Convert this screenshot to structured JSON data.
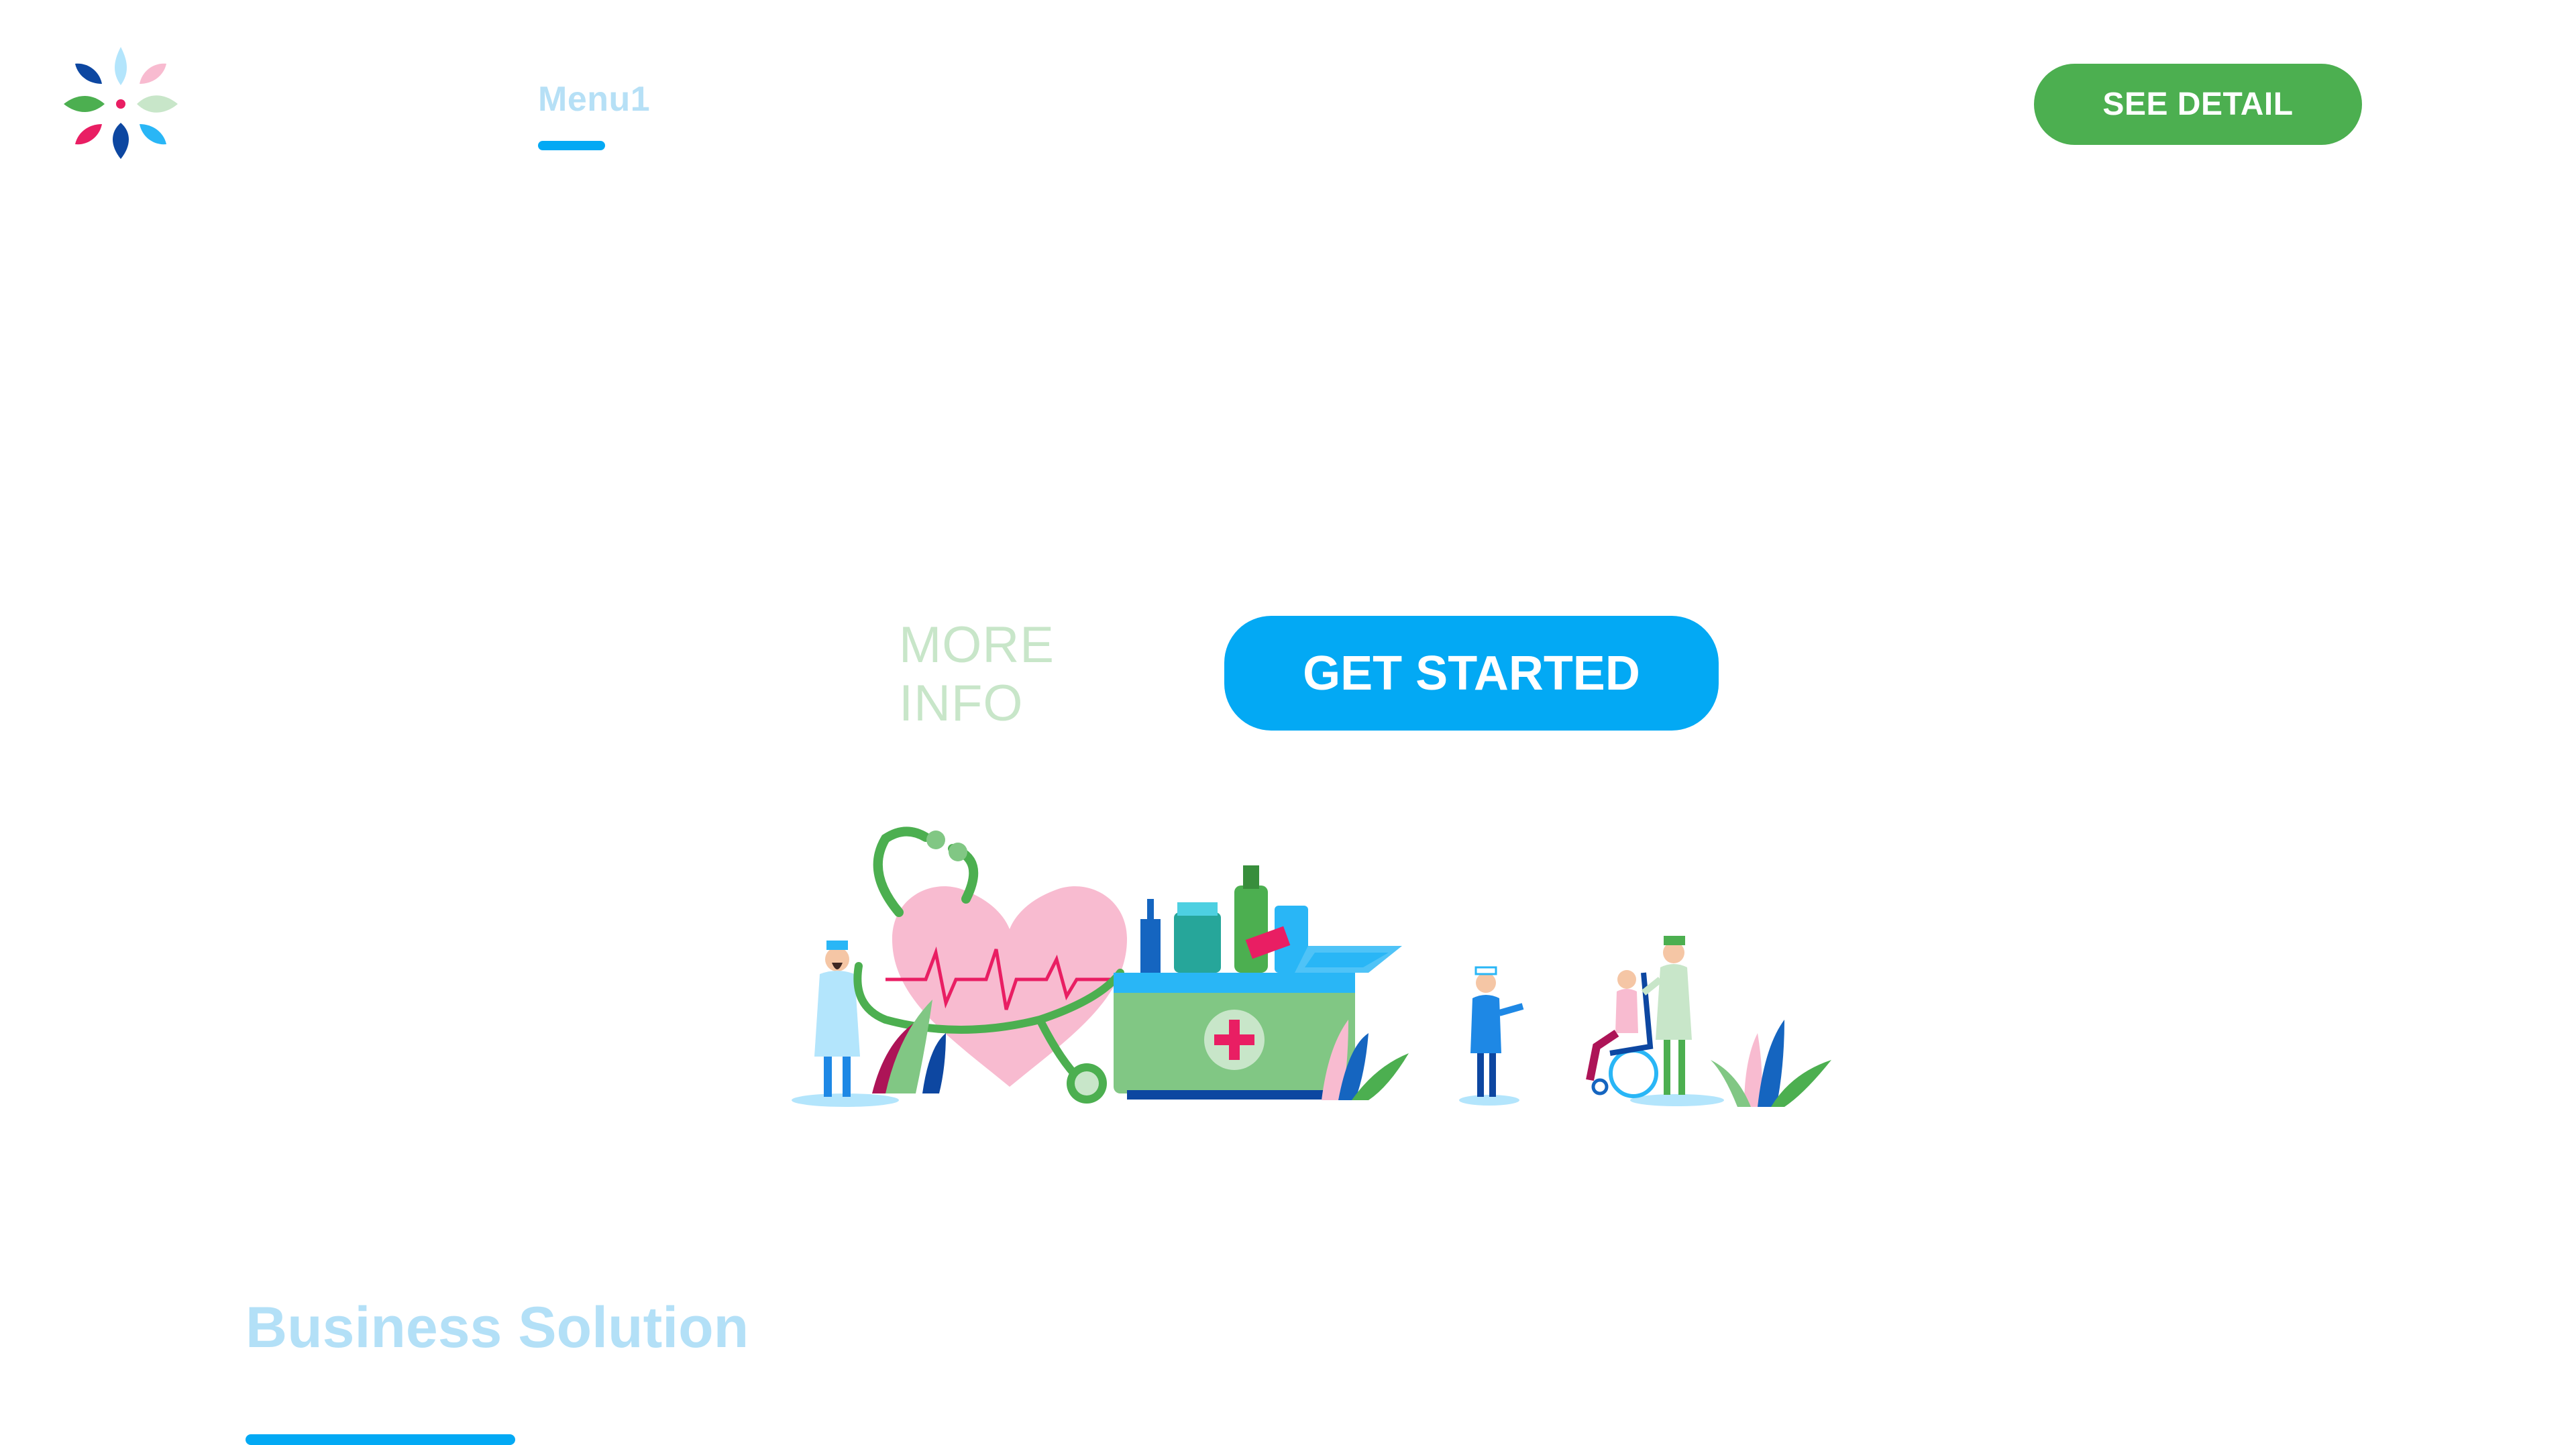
{
  "header": {
    "logo_icon": "flower-petal-logo",
    "nav": [
      {
        "label": "Menu1",
        "active": true
      }
    ],
    "cta_label": "SEE DETAIL"
  },
  "hero": {
    "more_info_label": "MORE INFO",
    "get_started_label": "GET STARTED",
    "illustration_icon": "medical-care-illustration"
  },
  "section": {
    "title": "Business Solution"
  },
  "colors": {
    "primary_blue": "#03a9f4",
    "primary_green": "#4caf50",
    "light_blue_text": "#b3e0f7",
    "light_green_text": "#c8e6c9",
    "heart_pink": "#f8bbd0",
    "accent_red": "#e91e63"
  }
}
